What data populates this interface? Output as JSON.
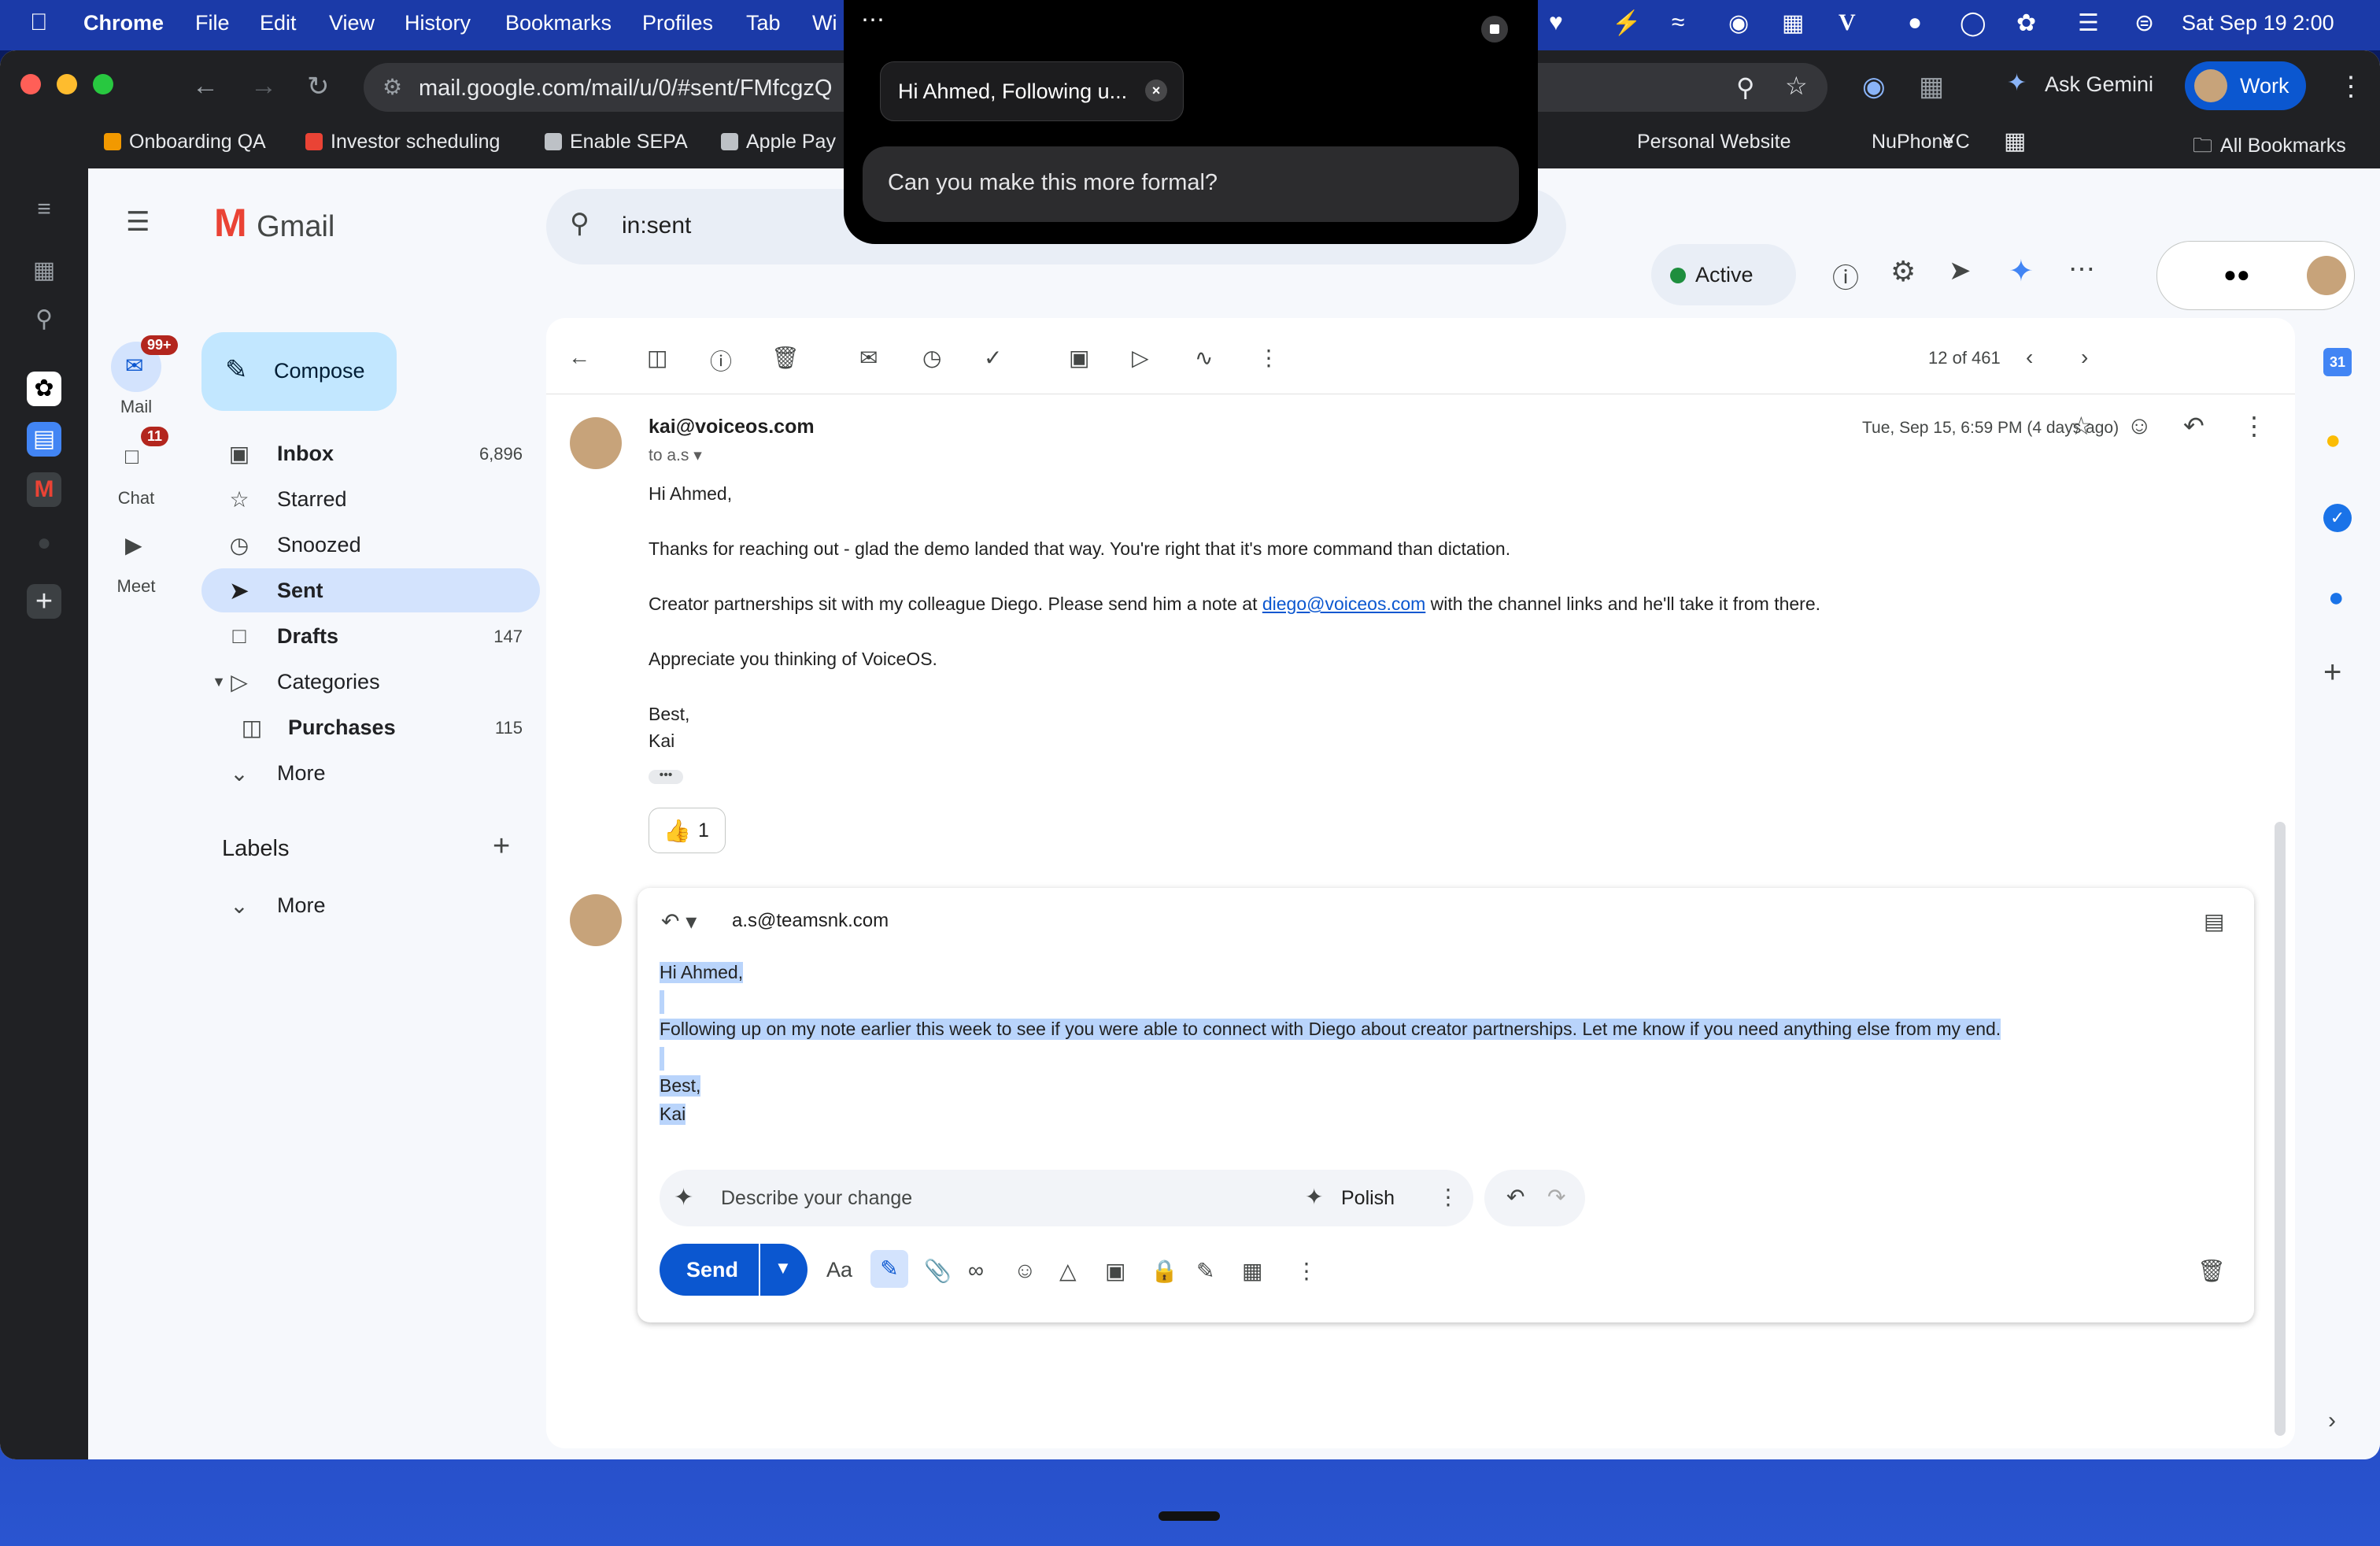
{
  "menubar": {
    "app": "Chrome",
    "items": [
      "File",
      "Edit",
      "View",
      "History",
      "Bookmarks",
      "Profiles",
      "Tab",
      "Wi"
    ],
    "clock": "Sat Sep 19  2:00"
  },
  "browser": {
    "url": "mail.google.com/mail/u/0/#sent/FMfcgzQ",
    "ask_gemini": "Ask Gemini",
    "profile": "Work",
    "bookmarks": [
      "Onboarding QA",
      "Investor scheduling",
      "Enable SEPA",
      "Apple Pay",
      "Personal Website",
      "NuPhone",
      "YC"
    ],
    "all_bookmarks": "All Bookmarks"
  },
  "overlay": {
    "chip_text": "Hi Ahmed, Following u...",
    "prompt_text": "Can you make this more formal?"
  },
  "gmail": {
    "brand": "Gmail",
    "search_query": "in:sent",
    "status": "Active",
    "rail": [
      {
        "label": "Mail",
        "badge": "99+"
      },
      {
        "label": "Chat",
        "badge": "11"
      },
      {
        "label": "Meet"
      }
    ],
    "compose_label": "Compose",
    "nav": [
      {
        "label": "Inbox",
        "count": "6,896"
      },
      {
        "label": "Starred"
      },
      {
        "label": "Snoozed"
      },
      {
        "label": "Sent"
      },
      {
        "label": "Drafts",
        "count": "147"
      },
      {
        "label": "Categories"
      },
      {
        "label": "Purchases",
        "count": "115"
      },
      {
        "label": "More"
      }
    ],
    "labels_header": "Labels",
    "labels_more": "More",
    "pager": "12 of 461"
  },
  "message": {
    "from": "kai@voiceos.com",
    "to": "to a.s",
    "date": "Tue, Sep 15, 6:59 PM (4 days ago)",
    "greeting": "Hi Ahmed,",
    "p1": "Thanks for reaching out - glad the demo landed that way. You're right that it's more command than dictation.",
    "p2_pre": "Creator partnerships sit with my colleague Diego. Please send him a note at ",
    "p2_link": "diego@voiceos.com",
    "p2_post": " with the channel links and he'll take it from there.",
    "p3": "Appreciate you thinking of VoiceOS.",
    "signoff": "Best,",
    "name": "Kai",
    "reaction_count": "1"
  },
  "reply": {
    "to": "a.s@teamsnk.com",
    "line1": "Hi Ahmed,",
    "line2": "Following up on my note earlier this week to see if you were able to connect with Diego about creator partnerships. Let me know if you need anything else from my end.",
    "line3": "Best,",
    "line4": "Kai",
    "ai_placeholder": "Describe your change",
    "polish": "Polish",
    "send": "Send",
    "format_label": "Aa"
  }
}
